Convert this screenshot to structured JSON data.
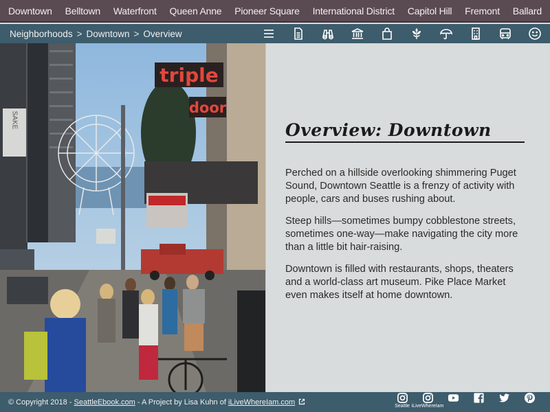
{
  "nav": {
    "items": [
      {
        "label": "Downtown"
      },
      {
        "label": "Belltown"
      },
      {
        "label": "Waterfront"
      },
      {
        "label": "Queen Anne"
      },
      {
        "label": "Pioneer Square"
      },
      {
        "label": "International District"
      },
      {
        "label": "Capitol Hill"
      },
      {
        "label": "Fremont"
      },
      {
        "label": "Ballard"
      }
    ]
  },
  "breadcrumb": {
    "items": [
      "Neighborhoods",
      "Downtown",
      "Overview"
    ],
    "separator": ">"
  },
  "toolbar_icons": [
    "menu-icon",
    "document-icon",
    "binoculars-icon",
    "museum-icon",
    "shopping-bag-icon",
    "leaf-icon",
    "umbrella-icon",
    "building-icon",
    "bus-icon",
    "smiley-icon"
  ],
  "photo": {
    "signs": {
      "sign1": "triple",
      "sign2": "door",
      "sign3": "SAKE"
    }
  },
  "content": {
    "title": "Overview: Downtown",
    "paragraphs": [
      "Perched on a hillside overlooking shimmering Puget Sound, Downtown Seattle is a frenzy of activity with people, cars and buses rushing about.",
      "Steep hills—sometimes bumpy cobblestone streets, sometimes one-way—make navigating the city more than a little bit hair-raising.",
      "Downtown is filled with restaurants, shops, theaters and a world-class art museum. Pike Place Market even makes itself at home downtown."
    ]
  },
  "footer": {
    "copyright": "© Copyright 2018 - ",
    "site_link": "SeattleEbook.com",
    "middle": " - A Project by Lisa Kuhn of ",
    "author_link": "iLiveWhereIam.com",
    "social": [
      {
        "icon": "instagram-icon",
        "caption": "Seattle"
      },
      {
        "icon": "instagram-icon",
        "caption": "iLiveWhereIam"
      },
      {
        "icon": "youtube-icon",
        "caption": ""
      },
      {
        "icon": "facebook-icon",
        "caption": ""
      },
      {
        "icon": "twitter-icon",
        "caption": ""
      },
      {
        "icon": "pinterest-icon",
        "caption": ""
      }
    ]
  },
  "colors": {
    "nav_bg": "#5a4a52",
    "bar_bg": "#3d5c6c",
    "content_bg": "#d9dcdc"
  }
}
